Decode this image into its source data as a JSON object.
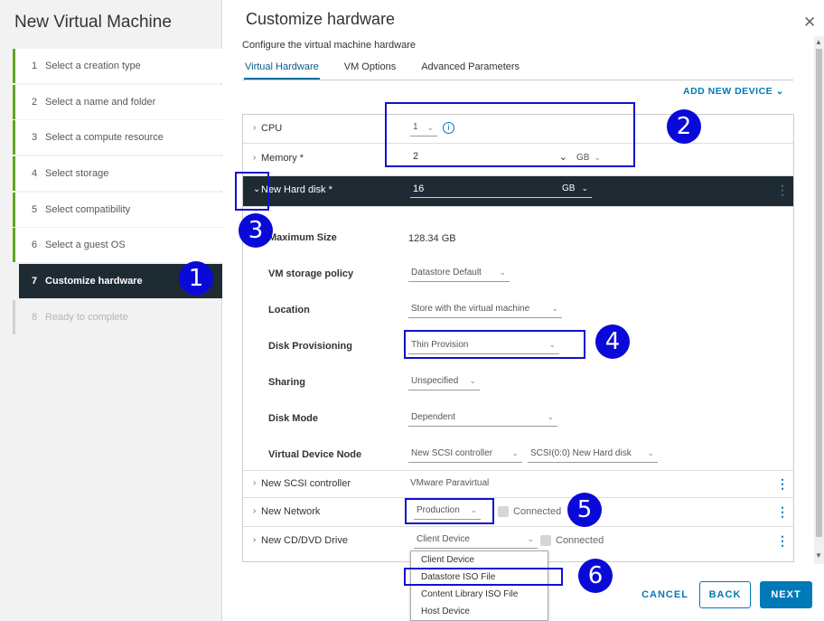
{
  "wizard": {
    "title": "New Virtual Machine",
    "steps": [
      {
        "num": "1",
        "label": "Select a creation type"
      },
      {
        "num": "2",
        "label": "Select a name and folder"
      },
      {
        "num": "3",
        "label": "Select a compute resource"
      },
      {
        "num": "4",
        "label": "Select storage"
      },
      {
        "num": "5",
        "label": "Select compatibility"
      },
      {
        "num": "6",
        "label": "Select a guest OS"
      },
      {
        "num": "7",
        "label": "Customize hardware"
      },
      {
        "num": "8",
        "label": "Ready to complete"
      }
    ]
  },
  "main": {
    "title": "Customize hardware",
    "subtitle": "Configure the virtual machine hardware",
    "tabs": [
      "Virtual Hardware",
      "VM Options",
      "Advanced Parameters"
    ],
    "add_device": "ADD NEW DEVICE"
  },
  "hardware": {
    "cpu": {
      "label": "CPU",
      "value": "1"
    },
    "memory": {
      "label": "Memory *",
      "value": "2",
      "unit": "GB"
    },
    "disk": {
      "label": "New Hard disk *",
      "value": "16",
      "unit": "GB",
      "max_size_label": "Maximum Size",
      "max_size": "128.34 GB",
      "storage_policy_label": "VM storage policy",
      "storage_policy": "Datastore Default",
      "location_label": "Location",
      "location": "Store with the virtual machine",
      "provisioning_label": "Disk Provisioning",
      "provisioning": "Thin Provision",
      "sharing_label": "Sharing",
      "sharing": "Unspecified",
      "mode_label": "Disk Mode",
      "mode": "Dependent",
      "node_label": "Virtual Device Node",
      "node_controller": "New SCSI controller",
      "node_slot": "SCSI(0:0) New Hard disk"
    },
    "scsi": {
      "label": "New SCSI controller",
      "value": "VMware Paravirtual"
    },
    "network": {
      "label": "New Network",
      "value": "Production",
      "connected": "Connected"
    },
    "cddvd": {
      "label": "New CD/DVD Drive",
      "value": "Client Device",
      "connected": "Connected"
    }
  },
  "cd_dropdown": [
    "Client Device",
    "Datastore ISO File",
    "Content Library ISO File",
    "Host Device"
  ],
  "footer": {
    "cancel": "CANCEL",
    "back": "BACK",
    "next": "NEXT"
  },
  "annotations": [
    "1",
    "2",
    "3",
    "4",
    "5",
    "6"
  ],
  "colors": {
    "accent": "#0079b8",
    "active_step": "#1f2b33",
    "step_border": "#62a420",
    "annotation": "#0a0ad8"
  }
}
